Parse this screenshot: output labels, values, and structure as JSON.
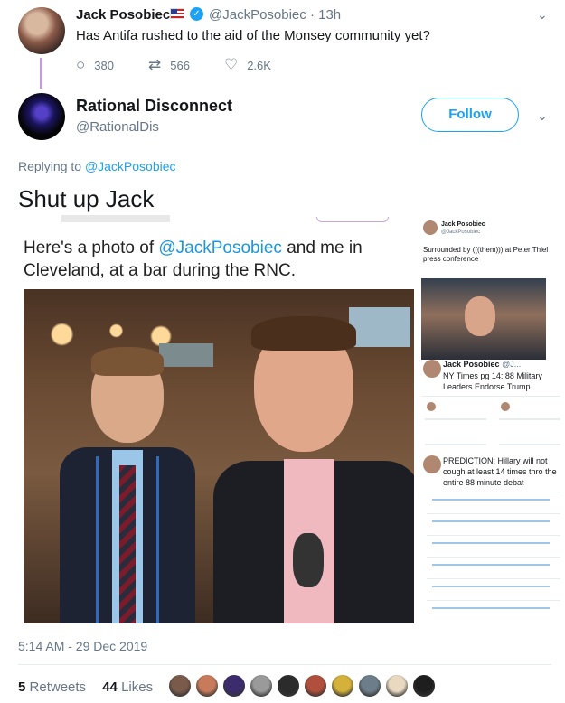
{
  "parent_tweet": {
    "name": "Jack Posobiec",
    "handle": "@JackPosobiec",
    "time": "13h",
    "text": "Has Antifa rushed to the aid of the Monsey community yet?",
    "replies": "380",
    "retweets": "566",
    "likes": "2.6K",
    "icons": [
      "us-flag-icon",
      "verified-badge-icon",
      "reply-icon",
      "retweet-icon",
      "heart-icon",
      "chevron-down-icon"
    ]
  },
  "tweet": {
    "name": "Rational Disconnect",
    "handle": "@RationalDis",
    "follow_label": "Follow",
    "replying_prefix": "Replying to",
    "replying_to": "@JackPosobiec",
    "text": "Shut up Jack",
    "timestamp": "5:14 AM - 29 Dec 2019",
    "retweet_count": "5",
    "retweet_label": "Retweets",
    "like_count": "44",
    "like_label": "Likes",
    "liker_count": 10
  },
  "embedded_image": {
    "caption_prefix": "Here's a photo of",
    "caption_mention": "@JackPosobiec",
    "caption_suffix": "and me in Cleveland, at a bar during the RNC.",
    "side_card1": {
      "name": "Jack Posobiec",
      "handle": "@JackPosobiec",
      "text": "Surrounded by (((them))) at Peter Thiel press conference"
    },
    "side_card2": {
      "name": "Jack Posobiec",
      "handle": "@J...",
      "text": "NY Times pg 14: 88 Military Leaders Endorse Trump"
    },
    "side_card3": {
      "text": "PREDICTION: Hillary will not cough at least 14 times thro the entire 88 minute debat"
    }
  },
  "colors": {
    "accent": "#1da1f2",
    "secondary_text": "#657786",
    "thread_line": "#c49dd8"
  }
}
